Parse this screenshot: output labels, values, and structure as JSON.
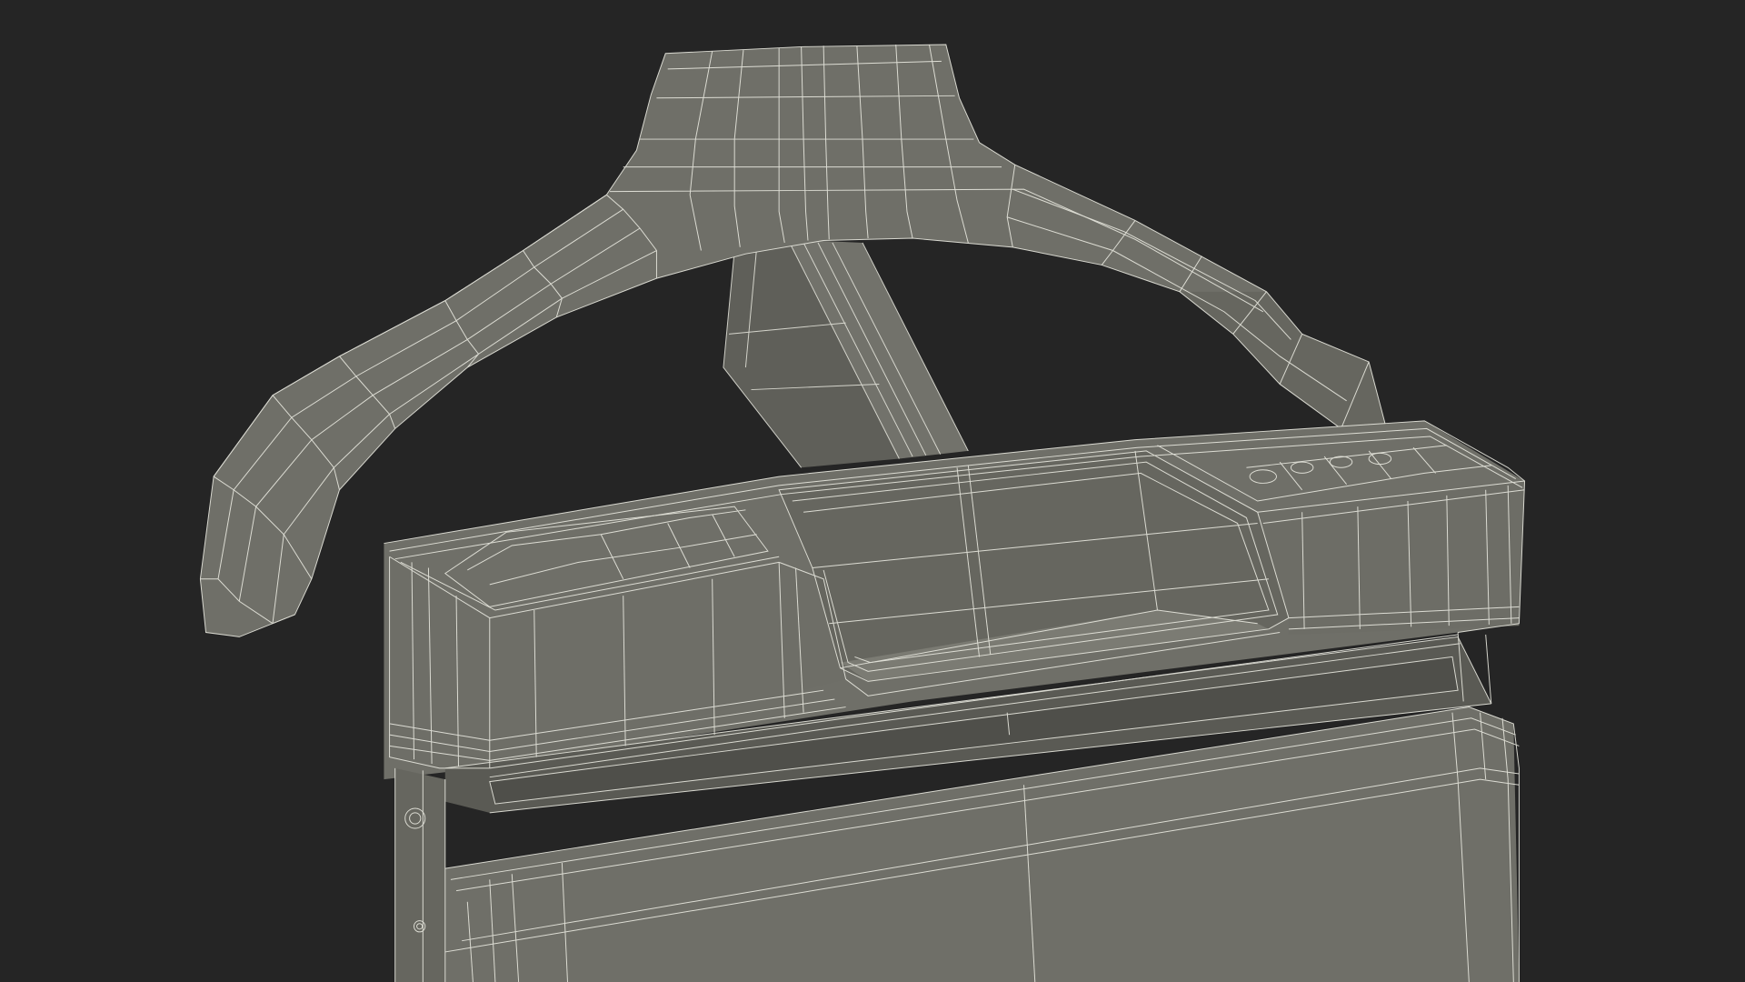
{
  "scene": {
    "subject": "trouser-press-valet-wireframe-render",
    "colors": {
      "background": "#252525",
      "surface": "#6f6f68",
      "surface_light": "#7a7a72",
      "surface_dark": "#5c5c56",
      "wire": "#e9e9e0"
    }
  }
}
